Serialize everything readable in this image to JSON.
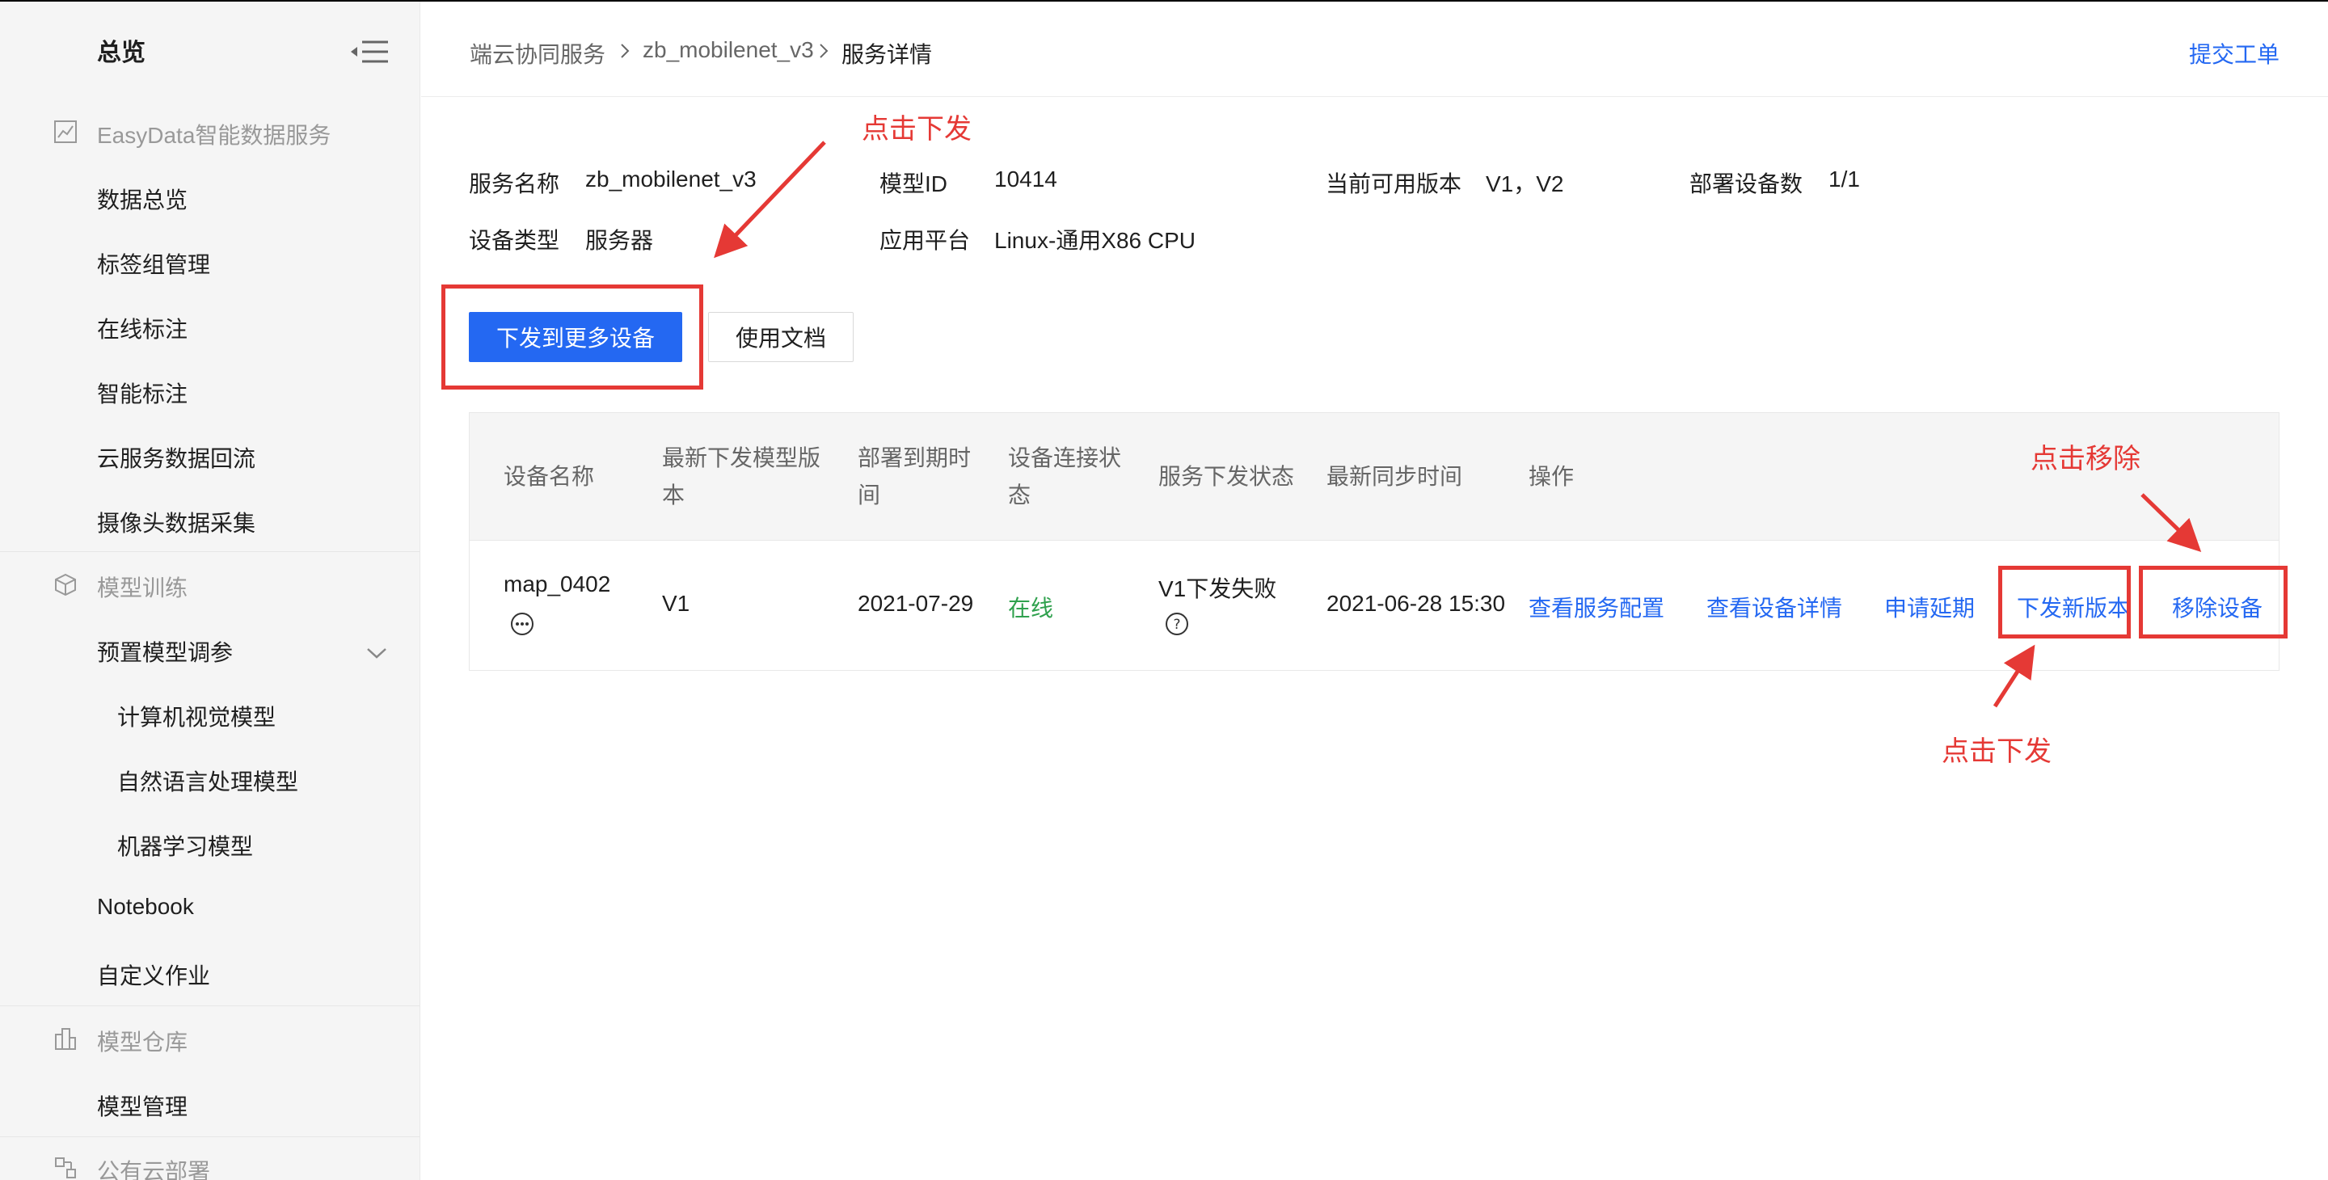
{
  "colors": {
    "accent": "#2468f2",
    "annotation": "#e53935",
    "online": "#30a14e"
  },
  "sidebar": {
    "title": "总览",
    "collapse_icon": "menu-collapse-icon",
    "groups": [
      {
        "label": "EasyData智能数据服务",
        "icon": "chart-icon"
      },
      {
        "label": "模型训练",
        "icon": "cube-icon"
      },
      {
        "label": "模型仓库",
        "icon": "warehouse-icon"
      },
      {
        "label": "公有云部署",
        "icon": "cloud-deploy-icon"
      }
    ],
    "items": [
      "数据总览",
      "标签组管理",
      "在线标注",
      "智能标注",
      "云服务数据回流",
      "摄像头数据采集",
      "预置模型调参",
      "计算机视觉模型",
      "自然语言处理模型",
      "机器学习模型",
      "Notebook",
      "自定义作业",
      "模型管理"
    ]
  },
  "header": {
    "breadcrumb": [
      "端云协同服务",
      "zb_mobilenet_v3",
      "服务详情"
    ],
    "submit_ticket": "提交工单"
  },
  "info": {
    "service_name_label": "服务名称",
    "service_name": "zb_mobilenet_v3",
    "model_id_label": "模型ID",
    "model_id": "10414",
    "versions_label": "当前可用版本",
    "versions": "V1，V2",
    "device_count_label": "部署设备数",
    "device_count": "1/1",
    "device_type_label": "设备类型",
    "device_type": "服务器",
    "platform_label": "应用平台",
    "platform": "Linux-通用X86 CPU"
  },
  "buttons": {
    "deploy_more": "下发到更多设备",
    "docs": "使用文档"
  },
  "table": {
    "headers": [
      "设备名称",
      "最新下发模型版本",
      "部署到期时间",
      "设备连接状态",
      "服务下发状态",
      "最新同步时间",
      "操作"
    ],
    "rows": [
      {
        "device_name": "map_0402",
        "version": "V1",
        "expire": "2021-07-29",
        "connection": "在线",
        "deploy_status": "V1下发失败",
        "sync_time": "2021-06-28 15:30",
        "actions": [
          "查看服务配置",
          "查看设备详情",
          "申请延期",
          "下发新版本",
          "移除设备"
        ]
      }
    ]
  },
  "annotations": {
    "top": "点击下发",
    "remove": "点击移除",
    "bottom": "点击下发"
  }
}
